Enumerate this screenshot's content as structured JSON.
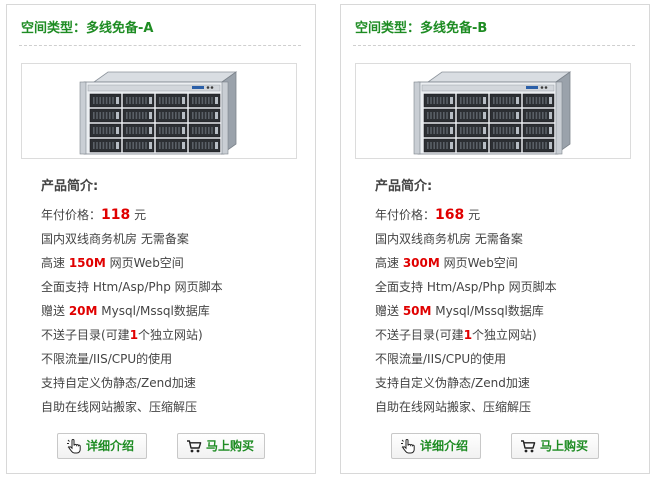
{
  "products": [
    {
      "title": "空间类型：多线免备-A",
      "intro_heading": "产品简介:",
      "price_label": "年付价格：",
      "price_value": "118",
      "price_unit": " 元",
      "feature_room": "国内双线商务机房 无需备案",
      "speed_prefix": "高速 ",
      "speed_value": "150M",
      "speed_suffix": " 网页Web空间",
      "support_line": "全面支持 Htm/Asp/Php 网页脚本",
      "db_prefix": "赠送 ",
      "db_value": "20M",
      "db_suffix": " Mysql/Mssql数据库",
      "subdir_prefix": "不送子目录(可建",
      "subdir_value": "1",
      "subdir_suffix": "个独立网站)",
      "traffic_line": "不限流量/IIS/CPU的使用",
      "rewrite_line": "支持自定义伪静态/Zend加速",
      "migrate_line": "自助在线网站搬家、压缩解压",
      "detail_label": "详细介绍",
      "buy_label": "马上购买"
    },
    {
      "title": "空间类型：多线免备-B",
      "intro_heading": "产品简介:",
      "price_label": "年付价格：",
      "price_value": "168",
      "price_unit": " 元",
      "feature_room": "国内双线商务机房 无需备案",
      "speed_prefix": "高速 ",
      "speed_value": "300M",
      "speed_suffix": " 网页Web空间",
      "support_line": "全面支持 Htm/Asp/Php 网页脚本",
      "db_prefix": "赠送 ",
      "db_value": "50M",
      "db_suffix": " Mysql/Mssql数据库",
      "subdir_prefix": "不送子目录(可建",
      "subdir_value": "1",
      "subdir_suffix": "个独立网站)",
      "traffic_line": "不限流量/IIS/CPU的使用",
      "rewrite_line": "支持自定义伪静态/Zend加速",
      "migrate_line": "自助在线网站搬家、压缩解压",
      "detail_label": "详细介绍",
      "buy_label": "马上购买"
    }
  ],
  "icons": {
    "detail": "hand-pointer-icon",
    "buy": "shopping-cart-icon",
    "product_image": "rack-server-image"
  },
  "colors": {
    "title_green": "#1e8c23",
    "price_red": "#e00000"
  }
}
